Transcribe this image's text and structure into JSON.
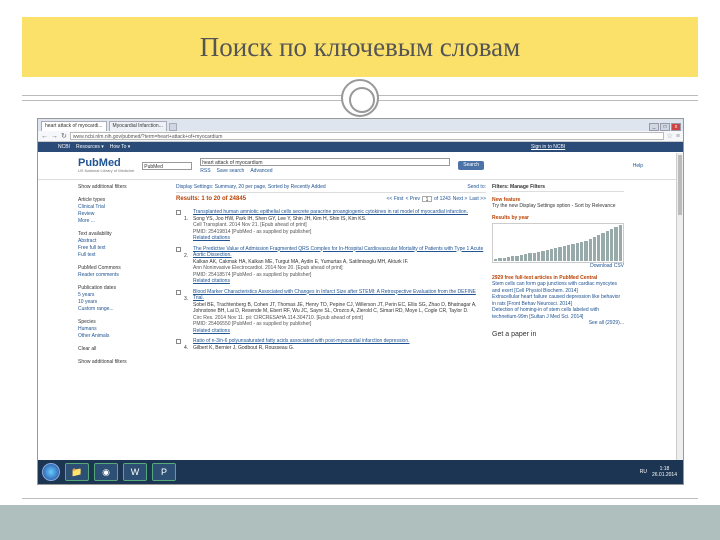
{
  "slide": {
    "title": "Поиск по ключевым словам"
  },
  "browser": {
    "tabs": [
      "heart attack of myocardi...",
      "Myocardial Infarction..."
    ],
    "url": "www.ncbi.nlm.nih.gov/pubmed/?term=heart+attack+of+myocardium",
    "controls": [
      "_",
      "□",
      "x"
    ]
  },
  "ncbi_bar": {
    "logo": "NCBI",
    "resources": "Resources ▾",
    "howto": "How To ▾",
    "signin": "Sign in to NCBI"
  },
  "pubmed": {
    "logo": "PubMed",
    "logo_sub": "US National Library of Medicine",
    "db": "PubMed",
    "query": "heart attack of myocardium",
    "links": [
      "RSS",
      "Save search",
      "Advanced"
    ],
    "search_btn": "Search",
    "help": "Help"
  },
  "left": [
    {
      "h": "Show additional filters"
    },
    {
      "h": "Article types",
      "items": [
        "Clinical Trial",
        "Review",
        "More ..."
      ]
    },
    {
      "h": "Text availability",
      "items": [
        "Abstract",
        "Free full text",
        "Full text"
      ]
    },
    {
      "h": "PubMed Commons",
      "items": [
        "Reader comments"
      ]
    },
    {
      "h": "Publication dates",
      "items": [
        "5 years",
        "10 years",
        "Custom range..."
      ]
    },
    {
      "h": "Species",
      "items": [
        "Humans",
        "Other Animals"
      ]
    },
    {
      "h": "Clear all"
    },
    {
      "h": "Show additional filters"
    }
  ],
  "display": {
    "settings": "Display Settings: Summary, 20 per page, Sorted by Recently Added",
    "send": "Send to:"
  },
  "results": {
    "label": "Results: 1 to 20 of 24845",
    "first": "<< First",
    "prev": "< Prev",
    "page": "1",
    "of": "of 1243",
    "next": "Next >",
    "last": "Last >>"
  },
  "items": [
    {
      "n": "1.",
      "title": "Transplanted human amniotic epithelial cells secrete paracrine proangiogenic cytokines in rat model of myocardial infarction.",
      "authors": "Song YS, Joo HW, Park IH, Shen GY, Lee Y, Shin JH, Kim H, Shin IS, Kim KS.",
      "journal": "Cell Transplant. 2014 Nov 21. [Epub ahead of print]",
      "pmid": "PMID: 25419814 [PubMed - as supplied by publisher]",
      "related": "Related citations"
    },
    {
      "n": "2.",
      "title": "The Predictive Value of Admission Fragmented QRS Complex for In-Hospital Cardiovascular Mortality of Patients with Type 1 Acute Aortic Dissection.",
      "authors": "Kalkan AK, Cakmak HA, Kalkan ME, Turgut MA, Aydin E, Yumurtas A, Satilmisoglu MH, Akturk IF.",
      "journal": "Ann Noninvasive Electrocardiol. 2014 Nov 20. [Epub ahead of print]",
      "pmid": "PMID: 25418574 [PubMed - as supplied by publisher]",
      "related": "Related citations"
    },
    {
      "n": "3.",
      "title": "Blood Marker Characteristics Associated with Changes in Infarct Size after STEMI: A Retrospective Evaluation from the DEFINE Trial.",
      "authors": "Sobel BE, Trachtenberg B, Cohen JT, Thomas JE, Henry TD, Pepine CJ, Willerson JT, Perin EC, Ellis SG, Zhao D, Bhatnagar A, Johnstone BH, Lai D, Resende M, Ebert RF, Wu JC, Sayre SL, Orozco A, Zierold C, Simari RD, Moye L, Cogle CR, Taylor D.",
      "journal": "Circ Res. 2014 Nov 11. pii: CIRCRESAHA.114.304710. [Epub ahead of print]",
      "pmid": "PMID: 25406550 [PubMed - as supplied by publisher]",
      "related": "Related citations"
    },
    {
      "n": "4.",
      "title": "Ratio of n-3/n-6 polyunsaturated fatty acids associated with post-myocardial infarction depression.",
      "authors": "Gilbert K, Bernier J, Godbout R, Rousseau G.",
      "journal": "",
      "pmid": "",
      "related": ""
    }
  ],
  "right": {
    "filters": "Filters: Manage Filters",
    "new_feature": "New feature",
    "new_text": "Try the new Display Settings option - Sort by Relevance",
    "by_year": "Results by year",
    "download": "Download CSV",
    "bars": [
      2,
      3,
      3,
      4,
      5,
      5,
      6,
      7,
      8,
      8,
      9,
      10,
      11,
      12,
      13,
      14,
      15,
      16,
      17,
      18,
      19,
      20,
      22,
      24,
      26,
      28,
      30,
      32,
      34,
      36
    ],
    "free_head": "2929 free full-text articles in PubMed Central",
    "free_items": [
      "Stem cells can form gap junctions with cardiac myocytes and exert [Cell Physiol Biochem. 2014]",
      "Extracellular heart failure caused depression like behavior in rats [Front Behav Neurosci. 2014]",
      "Detection of homing-in of stem cells labeled with technetium-99m [Sultan J Med Sci. 2014]"
    ],
    "see_all": "See all (2929)...",
    "get_paper": "Get a paper in"
  },
  "taskbar": {
    "lang": "RU",
    "time": "1:18",
    "date": "26.01.2014"
  }
}
